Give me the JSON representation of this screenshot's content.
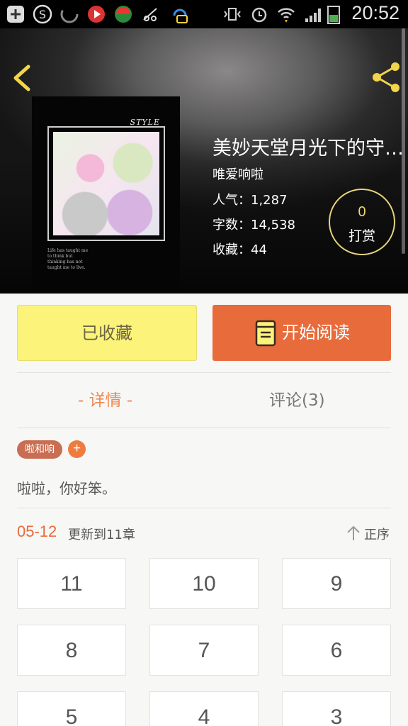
{
  "status_bar": {
    "time": "20:52"
  },
  "book": {
    "title": "美妙天堂月光下的守…",
    "author": "唯爱响啦",
    "popularity": "人气：1,287",
    "word_count": "字数：14,538",
    "favorites": "收藏：44",
    "cover": {
      "style_text": "STYLE",
      "caption": "Life has taught me to think but thinking has not taught me to live."
    }
  },
  "reward": {
    "count": "0",
    "label": "打赏"
  },
  "actions": {
    "collect_label": "已收藏",
    "read_label": "开始阅读"
  },
  "tabs": {
    "detail": "- 详情 -",
    "comments": "评论(3)"
  },
  "tags": [
    "啦和响"
  ],
  "tag_add": "+",
  "intro": "啦啦，你好笨。",
  "update": {
    "date": "05-12",
    "text": "更新到11章",
    "sort_label": "正序"
  },
  "chapters": [
    "11",
    "10",
    "9",
    "8",
    "7",
    "6",
    "5",
    "4",
    "3"
  ],
  "colors": {
    "accent": "#e86b3b",
    "collect_bg": "#fbf37a",
    "reward_ring": "#e8d57a"
  }
}
